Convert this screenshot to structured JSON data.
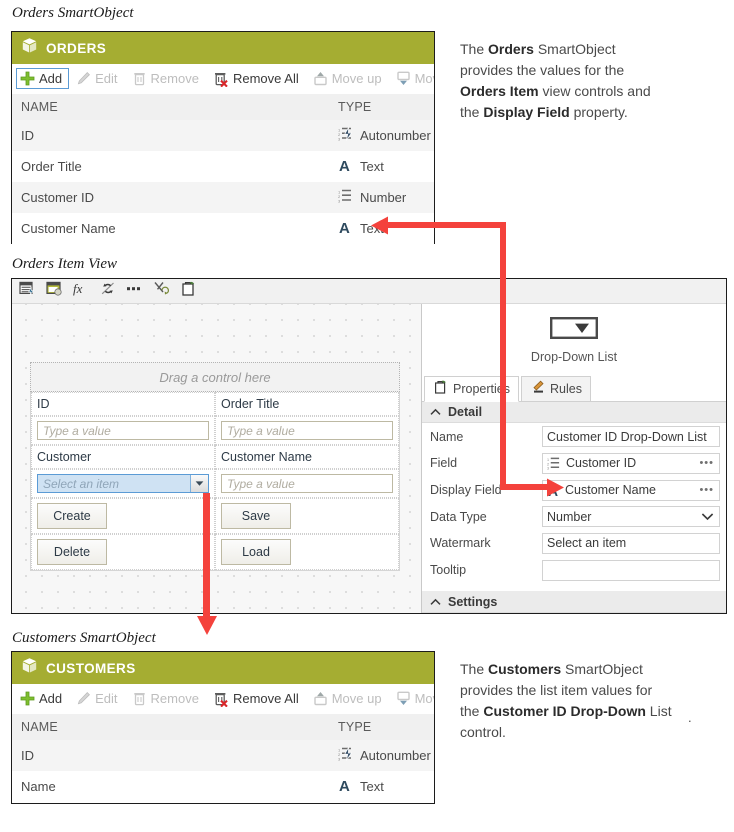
{
  "colors": {
    "smartobject_header": "#a5ad32",
    "arrow_red": "#f4423c",
    "selection_blue": "#5b9bd5",
    "type_icon_dark": "#2e4a5e"
  },
  "orders_section": {
    "caption": "Orders SmartObject",
    "header_title": "ORDERS",
    "header_icon": "cube-icon",
    "toolbar": [
      {
        "label": "Add",
        "icon": "plus-icon",
        "state": "selected"
      },
      {
        "label": "Edit",
        "icon": "pencil-icon",
        "state": "disabled"
      },
      {
        "label": "Remove",
        "icon": "trash-icon",
        "state": "disabled"
      },
      {
        "label": "Remove All",
        "icon": "trash-x-icon",
        "state": "enabled"
      },
      {
        "label": "Move up",
        "icon": "move-up-icon",
        "state": "disabled"
      },
      {
        "label": "Move down",
        "icon": "move-down-icon",
        "state": "disabled"
      }
    ],
    "columns": [
      "NAME",
      "TYPE"
    ],
    "rows": [
      {
        "name": "ID",
        "type": "Autonumber",
        "type_icon": "autonumber-icon"
      },
      {
        "name": "Order Title",
        "type": "Text",
        "type_icon": "text-icon"
      },
      {
        "name": "Customer ID",
        "type": "Number",
        "type_icon": "number-icon"
      },
      {
        "name": "Customer Name",
        "type": "Text",
        "type_icon": "text-icon"
      }
    ],
    "note": {
      "parts": [
        {
          "t": "The ",
          "b": false
        },
        {
          "t": "Orders",
          "b": true
        },
        {
          "t": " SmartObject provides the values for the ",
          "b": false
        },
        {
          "t": "Orders Item",
          "b": true
        },
        {
          "t": " view controls and the ",
          "b": false
        },
        {
          "t": "Display Field",
          "b": true
        },
        {
          "t": " property.",
          "b": false
        }
      ]
    }
  },
  "view_section": {
    "caption": "Orders Item View",
    "toolbar_icons": [
      "add-view-icon",
      "add-control-icon",
      "expression-icon",
      "association-icon",
      "more-icon",
      "cut-transfer-icon",
      "paste-icon"
    ],
    "canvas": {
      "dropzone_text": "Drag a control here",
      "fields": [
        {
          "label": "ID",
          "control": "textbox",
          "value": "Type a value"
        },
        {
          "label": "Order Title",
          "control": "textbox",
          "value": "Type a value"
        },
        {
          "label": "Customer",
          "control": "dropdown",
          "value": "Select an item"
        },
        {
          "label": "Customer Name",
          "control": "textbox",
          "value": "Type a value"
        }
      ],
      "buttons": [
        "Create",
        "Save",
        "Delete",
        "Load"
      ]
    },
    "properties_pane": {
      "control_icon": "drop-down-list-icon",
      "control_name": "Drop-Down List",
      "tabs": [
        {
          "label": "Properties",
          "icon": "properties-icon",
          "active": true
        },
        {
          "label": "Rules",
          "icon": "rules-gavel-icon",
          "active": false
        }
      ],
      "sections": [
        {
          "title": "Detail",
          "collapse_icon": "chevron-up-icon",
          "rows": [
            {
              "name": "Name",
              "value": "Customer ID Drop-Down List",
              "icon": "",
              "suffix": ""
            },
            {
              "name": "Field",
              "value": "Customer ID",
              "icon": "number-icon",
              "suffix": "ellipsis"
            },
            {
              "name": "Display Field",
              "value": "Customer Name",
              "icon": "text-icon",
              "suffix": "ellipsis"
            },
            {
              "name": "Data Type",
              "value": "Number",
              "icon": "",
              "suffix": "chevron"
            },
            {
              "name": "Watermark",
              "value": "Select an item",
              "icon": "",
              "suffix": ""
            },
            {
              "name": "Tooltip",
              "value": "",
              "icon": "",
              "suffix": ""
            }
          ]
        },
        {
          "title": "Settings",
          "collapse_icon": "chevron-up-icon",
          "rows": []
        }
      ]
    }
  },
  "customers_section": {
    "caption": "Customers SmartObject",
    "header_title": "CUSTOMERS",
    "header_icon": "cube-icon",
    "toolbar": [
      {
        "label": "Add",
        "icon": "plus-icon",
        "state": "enabled"
      },
      {
        "label": "Edit",
        "icon": "pencil-icon",
        "state": "disabled"
      },
      {
        "label": "Remove",
        "icon": "trash-icon",
        "state": "disabled"
      },
      {
        "label": "Remove All",
        "icon": "trash-x-icon",
        "state": "enabled"
      },
      {
        "label": "Move up",
        "icon": "move-up-icon",
        "state": "disabled"
      },
      {
        "label": "Move down",
        "icon": "move-down-icon",
        "state": "disabled"
      }
    ],
    "columns": [
      "NAME",
      "TYPE"
    ],
    "rows": [
      {
        "name": "ID",
        "type": "Autonumber",
        "type_icon": "autonumber-icon"
      },
      {
        "name": "Name",
        "type": "Text",
        "type_icon": "text-icon"
      }
    ],
    "note": {
      "parts": [
        {
          "t": "The ",
          "b": false
        },
        {
          "t": "Customers",
          "b": true
        },
        {
          "t": " SmartObject provides the list item values for the ",
          "b": false
        },
        {
          "t": "Customer ID Drop-Down",
          "b": true
        },
        {
          "t": " List control.",
          "b": false
        }
      ]
    }
  }
}
